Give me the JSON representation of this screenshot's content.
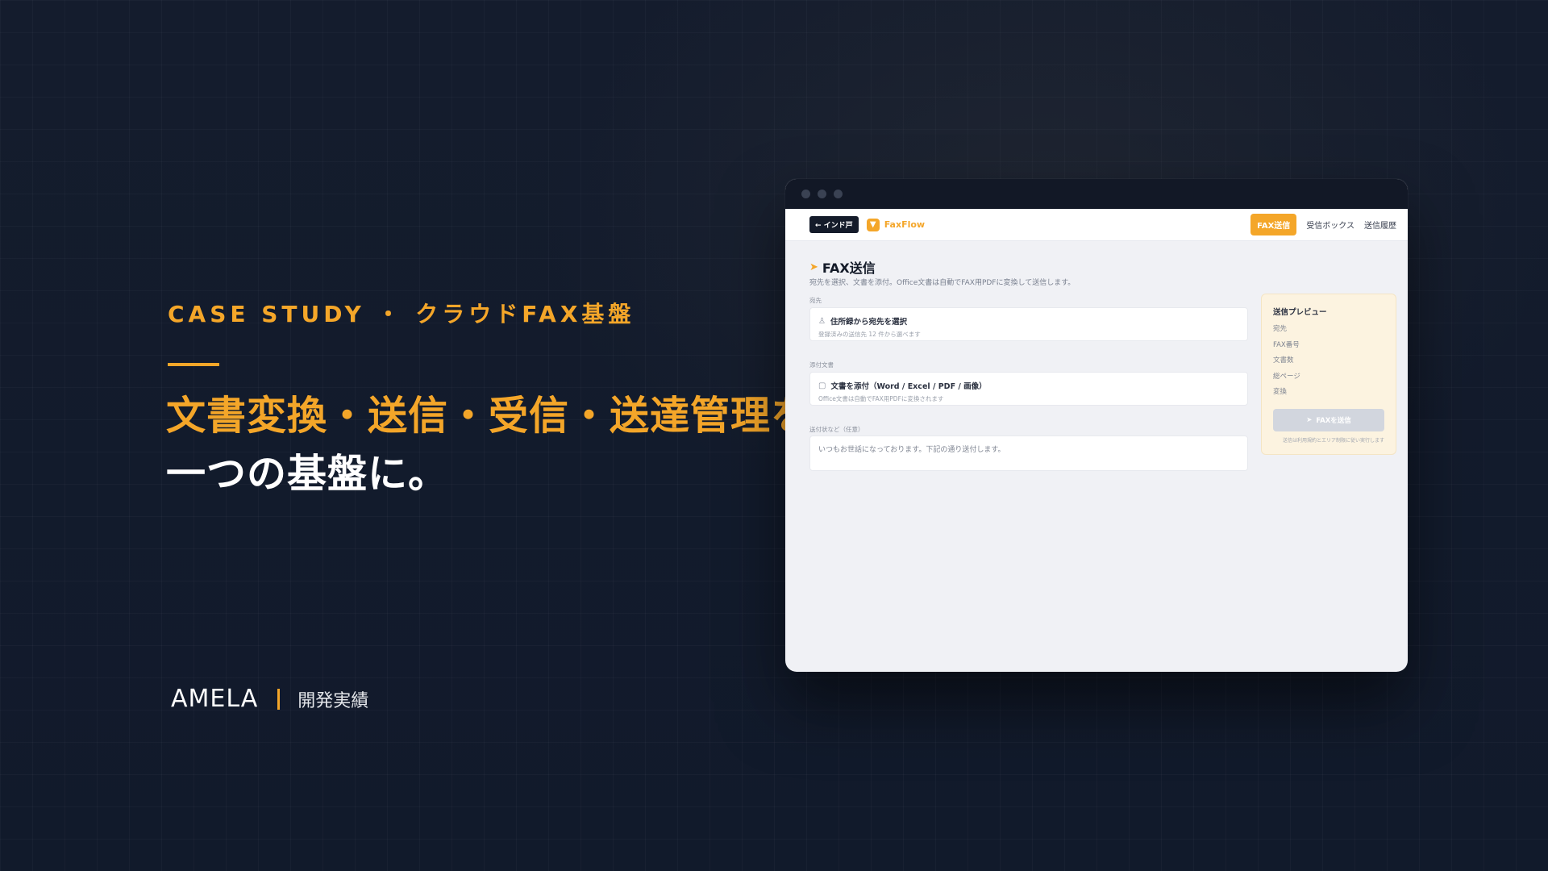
{
  "hero": {
    "eyebrow": "CASE STUDY ・ クラウドFAX基盤",
    "headline_line1": "文書変換・送信・受信・送達管理を、",
    "headline_line2": "一つの基盤に。"
  },
  "brand": {
    "name": "AMELA",
    "subtitle": "開発実績"
  },
  "app": {
    "back_label": "← インド戸",
    "logo_text": "FaxFlow",
    "nav": {
      "send": "FAX送信",
      "inbox": "受信ボックス",
      "history": "送信履歴"
    },
    "page_title": "FAX送信",
    "page_description": "宛先を選択、文書を添付。Office文書は自動でFAX用PDFに変換して送信します。",
    "recipient": {
      "label": "宛先",
      "title": "住所録から宛先を選択",
      "subtitle": "登録済みの送信先 12 件から選べます"
    },
    "attachment": {
      "label": "添付文書",
      "title": "文書を添付（Word / Excel / PDF / 画像）",
      "subtitle": "Office文書は自動でFAX用PDFに変換されます"
    },
    "cover_note": {
      "label": "送付状など（任意）",
      "value": "いつもお世話になっております。下記の通り送付します。"
    },
    "preview": {
      "title": "送信プレビュー",
      "rows": [
        "宛先",
        "FAX番号",
        "文書数",
        "総ページ",
        "変換"
      ],
      "send_button": "FAXを送信",
      "note": "送信は利用規約とエリア制限に従い実行します"
    }
  },
  "colors": {
    "accent": "#f4a629",
    "background": "#131b2b",
    "app_background": "#f0f1f5"
  }
}
